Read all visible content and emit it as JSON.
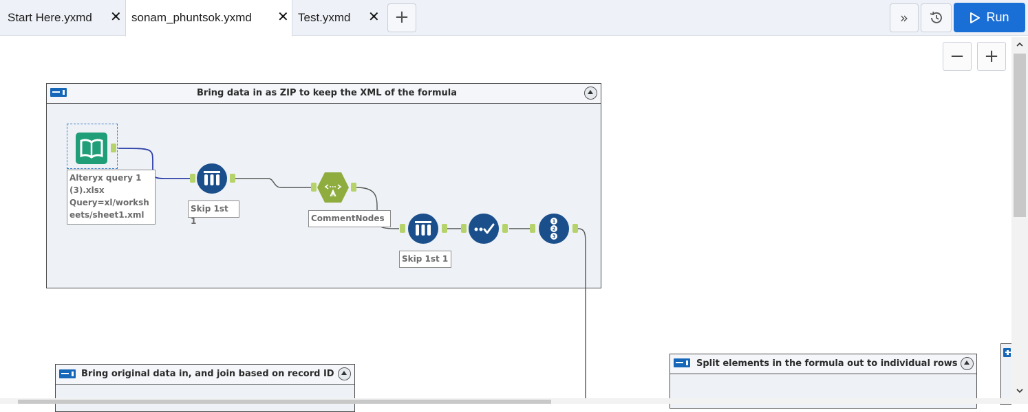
{
  "tabs": [
    {
      "label": "Start Here.yxmd",
      "close": "✕"
    },
    {
      "label": "sonam_phuntsok.yxmd",
      "close": "✕"
    },
    {
      "label": "Test.yxmd",
      "close": "✕"
    }
  ],
  "add_tab": "+",
  "toolbar": {
    "more": "»",
    "run_label": "Run"
  },
  "zoom": {
    "out": "−",
    "in": "+"
  },
  "containers": [
    {
      "caption": "Bring data in as ZIP to keep the XML of the formula"
    },
    {
      "caption": "Bring original data in, and join based on record ID"
    },
    {
      "caption": "Split elements in the formula out to individual rows"
    }
  ],
  "annotations": {
    "input_lines": [
      "Alteryx query 1",
      "(3).xlsx",
      "Query=xl/worksh",
      "eets/sheet1.xml"
    ],
    "skip1": "Skip 1st 1",
    "comment_nodes": "CommentNodes",
    "skip2": "Skip 1st 1"
  },
  "icons": {
    "input": "book-input-icon",
    "sample": "sample-tool-icon",
    "xml_parse": "xml-parse-icon",
    "select": "select-tool-icon",
    "record_id": "record-id-icon"
  },
  "colors": {
    "accent": "#1a6fd6",
    "tool_blue": "#1a4f8b",
    "tool_green": "#8fad3f",
    "input_teal": "#1f9e78",
    "anchor": "#b5d36a"
  }
}
